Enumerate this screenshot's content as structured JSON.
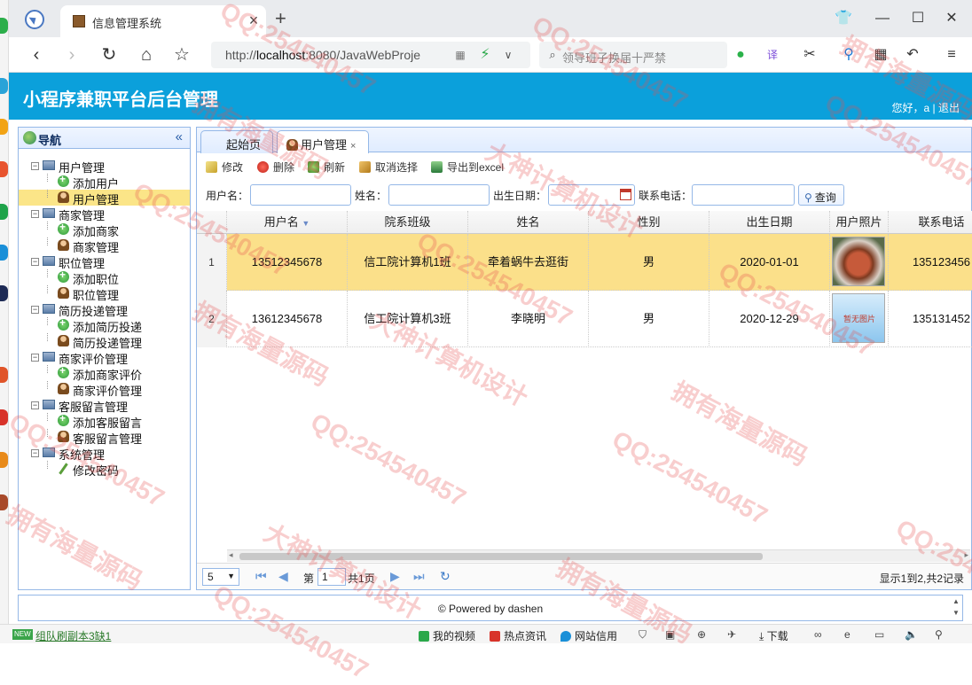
{
  "browser": {
    "tab_title": "信息管理系统",
    "tab_close": "×",
    "new_tab": "+",
    "url_prefix": "http://",
    "url_host": "localhost",
    "url_rest": ":8080/JavaWebProje",
    "search_placeholder": "领导班子换届十严禁",
    "window_controls": [
      "👕",
      "—",
      "☐",
      "✕"
    ]
  },
  "app": {
    "title": "小程序兼职平台后台管理",
    "greeting": "您好，a |",
    "logout": "退出"
  },
  "nav": {
    "title": "导航",
    "collapse": "«",
    "groups": [
      {
        "label": "用户管理",
        "items": [
          {
            "label": "添加用户",
            "icon": "add-icon"
          },
          {
            "label": "用户管理",
            "icon": "user-icon",
            "selected": true
          }
        ]
      },
      {
        "label": "商家管理",
        "items": [
          {
            "label": "添加商家",
            "icon": "add-icon"
          },
          {
            "label": "商家管理",
            "icon": "user-icon"
          }
        ]
      },
      {
        "label": "职位管理",
        "items": [
          {
            "label": "添加职位",
            "icon": "add-icon"
          },
          {
            "label": "职位管理",
            "icon": "user-icon"
          }
        ]
      },
      {
        "label": "简历投递管理",
        "items": [
          {
            "label": "添加简历投递",
            "icon": "add-icon"
          },
          {
            "label": "简历投递管理",
            "icon": "user-icon"
          }
        ]
      },
      {
        "label": "商家评价管理",
        "items": [
          {
            "label": "添加商家评价",
            "icon": "add-icon"
          },
          {
            "label": "商家评价管理",
            "icon": "user-icon"
          }
        ]
      },
      {
        "label": "客服留言管理",
        "items": [
          {
            "label": "添加客服留言",
            "icon": "add-icon"
          },
          {
            "label": "客服留言管理",
            "icon": "user-icon"
          }
        ]
      },
      {
        "label": "系统管理",
        "items": [
          {
            "label": "修改密码",
            "icon": "pen-icon"
          }
        ]
      }
    ]
  },
  "main": {
    "tabs": [
      {
        "label": "起始页"
      },
      {
        "label": "用户管理",
        "close": "×"
      }
    ],
    "toolbar": {
      "edit": "修改",
      "delete": "删除",
      "refresh": "刷新",
      "cancel_select": "取消选择",
      "export": "导出到excel"
    },
    "filters": {
      "username_label": "用户名：",
      "name_label": "姓名：",
      "birth_label": "出生日期：",
      "phone_label": "联系电话：",
      "query": "查询"
    },
    "table": {
      "columns": [
        "用户名",
        "院系班级",
        "姓名",
        "性别",
        "出生日期",
        "用户照片",
        "联系电话"
      ],
      "rows": [
        {
          "num": "1",
          "username": "13512345678",
          "class": "信工院计算机1班",
          "name": "牵着蜗牛去逛街",
          "gender": "男",
          "birth": "2020-01-01",
          "photo": "food-photo",
          "phone": "135123456"
        },
        {
          "num": "2",
          "username": "13612345678",
          "class": "信工院计算机3班",
          "name": "李晓明",
          "gender": "男",
          "birth": "2020-12-29",
          "photo": "暂无图片",
          "phone": "135131452"
        }
      ]
    },
    "pager": {
      "page_size": "5",
      "page_prefix": "第",
      "page_value": "1",
      "page_total": "共1页",
      "summary": "显示1到2,共2记录"
    }
  },
  "footer": {
    "text": "© Powered by dashen"
  },
  "statusbar": {
    "new_badge": "NEW",
    "game": "组队刷副本3缺1",
    "items": [
      "我的视频",
      "热点资讯",
      "网站信用",
      "下载"
    ]
  },
  "watermarks": [
    "QQ:254540457",
    "大神计算机设计",
    "拥有海量源码"
  ],
  "colors": {
    "header": "#0ba0db",
    "selection": "#fbe08a",
    "border": "#95b8e7"
  }
}
